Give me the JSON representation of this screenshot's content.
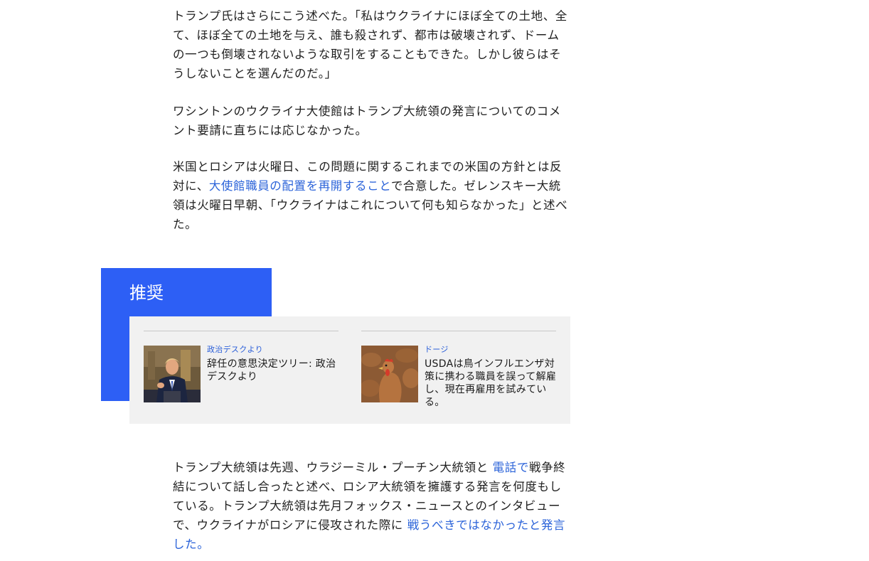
{
  "article": {
    "paragraph1": "トランプ氏はさらにこう述べた。「私はウクライナにほぼ全ての土地、全て、ほぼ全ての土地を与え、誰も殺されず、都市は破壊されず、ドームの一つも倒壊されないような取引をすることもできた。しかし彼らはそうしないことを選んだのだ。」",
    "paragraph2": "ワシントンのウクライナ大使館はトランプ大統領の発言についてのコメント要請に直ちには応じなかった。",
    "paragraph3": {
      "before": "米国とロシアは火曜日、この問題に関するこれまでの米国の方針とは反対に、",
      "link": "大使館職員の配置を再開すること",
      "after": "で合意した。ゼレンスキー大統領は火曜日早朝、「ウクライナはこれについて何も知らなかった」と述べた。"
    },
    "paragraph4": {
      "part1": "トランプ大統領は先週、ウラジーミル・プーチン大統領と ",
      "link1": "電話で",
      "part2": "戦争終結について話し合ったと述べ、ロシア大統領を擁護する発言を何度もしている。トランプ大統領は先月フォックス・ニュースとのインタビューで、ウクライナがロシアに侵攻された際に ",
      "link2": "戦うべきではなかったと発言した。"
    }
  },
  "recommended": {
    "title": "推奨",
    "cards": [
      {
        "tag": "政治デスクより",
        "headline": "辞任の意思決定ツリー: 政治デスクより",
        "thumb_icon": "politician-photo"
      },
      {
        "tag": "ドージ",
        "headline": "USDAは鳥インフルエンザ対策に携わる職員を誤って解雇し、現在再雇用を試みている。",
        "thumb_icon": "chicken-photo"
      }
    ]
  },
  "colors": {
    "accent_blue": "#2d5ff5",
    "link_blue": "#2b63d9",
    "panel_gray": "#f1f1f1"
  }
}
